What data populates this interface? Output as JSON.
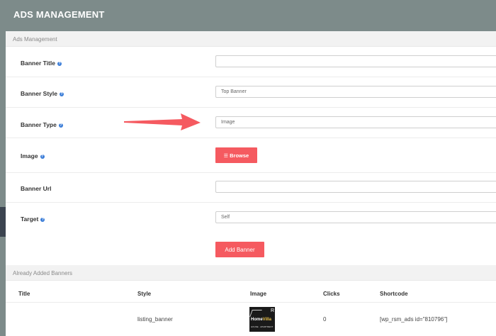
{
  "header": {
    "title": "ADS MANAGEMENT"
  },
  "form": {
    "section_title": "Ads Management",
    "banner_title": {
      "label": "Banner Title",
      "value": ""
    },
    "banner_style": {
      "label": "Banner Style",
      "value": "Top Banner"
    },
    "banner_type": {
      "label": "Banner Type",
      "value": "Image"
    },
    "image": {
      "label": "Image",
      "button": "Browse"
    },
    "banner_url": {
      "label": "Banner Url",
      "value": ""
    },
    "target": {
      "label": "Target",
      "value": "Self"
    },
    "submit": "Add Banner"
  },
  "banners": {
    "section_title": "Already Added Banners",
    "columns": [
      "Title",
      "Style",
      "Image",
      "Clicks",
      "Shortcode"
    ],
    "rows": [
      {
        "title": "",
        "style": "listing_banner",
        "image_brand": "HomeVilla",
        "image_brand_a": "Home",
        "image_brand_b": "Villa",
        "image_sub": "HOUSE · APARTMENT",
        "clicks": "0",
        "shortcode": "[wp_rsm_ads id=\"810796\"]"
      }
    ]
  },
  "colors": {
    "accent": "#f55a60",
    "header_bg": "#7d8b8a",
    "help_icon": "#3b7dd8"
  }
}
